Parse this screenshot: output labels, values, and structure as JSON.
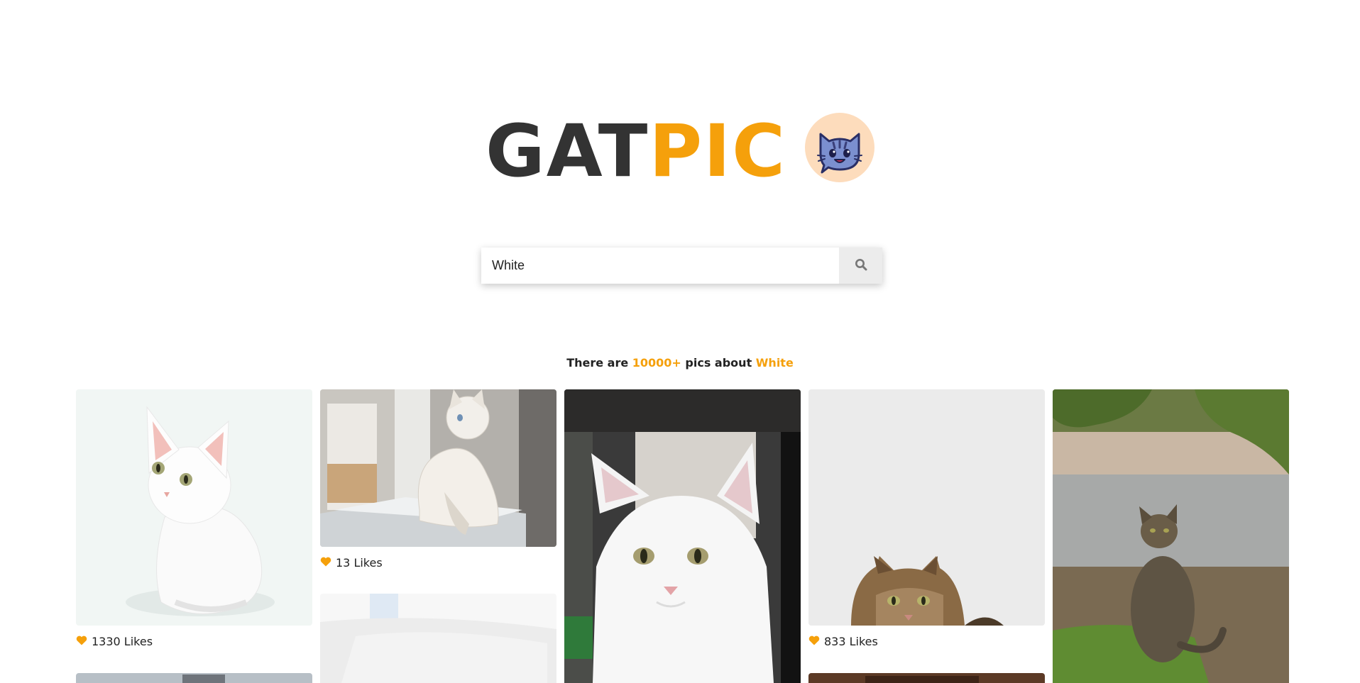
{
  "logo": {
    "part1": "GAT",
    "part2": "PIC",
    "badge_icon": "cat-chat-icon",
    "accent_color": "#f5a00b",
    "badge_color": "#fddcbc"
  },
  "search": {
    "value": "White",
    "button_icon": "search-icon"
  },
  "results": {
    "prefix": "There are ",
    "count": "10000+",
    "middle": " pics about ",
    "term": "White"
  },
  "gallery": {
    "like_icon": "heart-icon",
    "like_color": "#f5a00b",
    "items": [
      {
        "subject": "white kitten sitting",
        "likes": "1330 Likes"
      },
      {
        "subject": "white cat by window",
        "likes": "13 Likes"
      },
      {
        "subject": "white maine coon cat"
      },
      {
        "subject": "tabby cat peeking",
        "likes": "833 Likes"
      },
      {
        "subject": "tabby cat sitting outdoors"
      },
      {
        "subject": "partial photo"
      },
      {
        "subject": "partial photo"
      },
      {
        "subject": "partial photo"
      }
    ]
  }
}
